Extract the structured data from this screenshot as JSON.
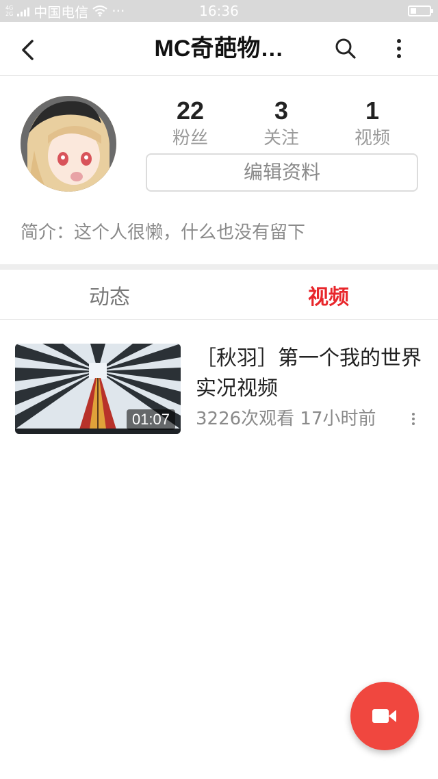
{
  "status_bar": {
    "network_tag_top": "4G",
    "network_tag_bottom": "2G",
    "carrier": "中国电信",
    "more": "···",
    "time": "16:36"
  },
  "header": {
    "title": "MC奇葩物…"
  },
  "profile": {
    "stats": [
      {
        "value": "22",
        "label": "粉丝"
      },
      {
        "value": "3",
        "label": "关注"
      },
      {
        "value": "1",
        "label": "视频"
      }
    ],
    "edit_button_label": "编辑资料",
    "bio": "简介：这个人很懒，什么也没有留下"
  },
  "tabs": [
    {
      "label": "动态",
      "active": false
    },
    {
      "label": "视频",
      "active": true
    }
  ],
  "videos": [
    {
      "title": "［秋羽］第一个我的世界实况视频",
      "duration": "01:07",
      "meta": "3226次观看 17小时前"
    }
  ],
  "colors": {
    "accent": "#e8262b",
    "fab": "#f0473f",
    "status_bar": "#d9d9d9"
  },
  "icons": {
    "back": "back-arrow-icon",
    "search": "search-icon",
    "more": "more-vertical-icon",
    "fab": "video-camera-icon"
  }
}
